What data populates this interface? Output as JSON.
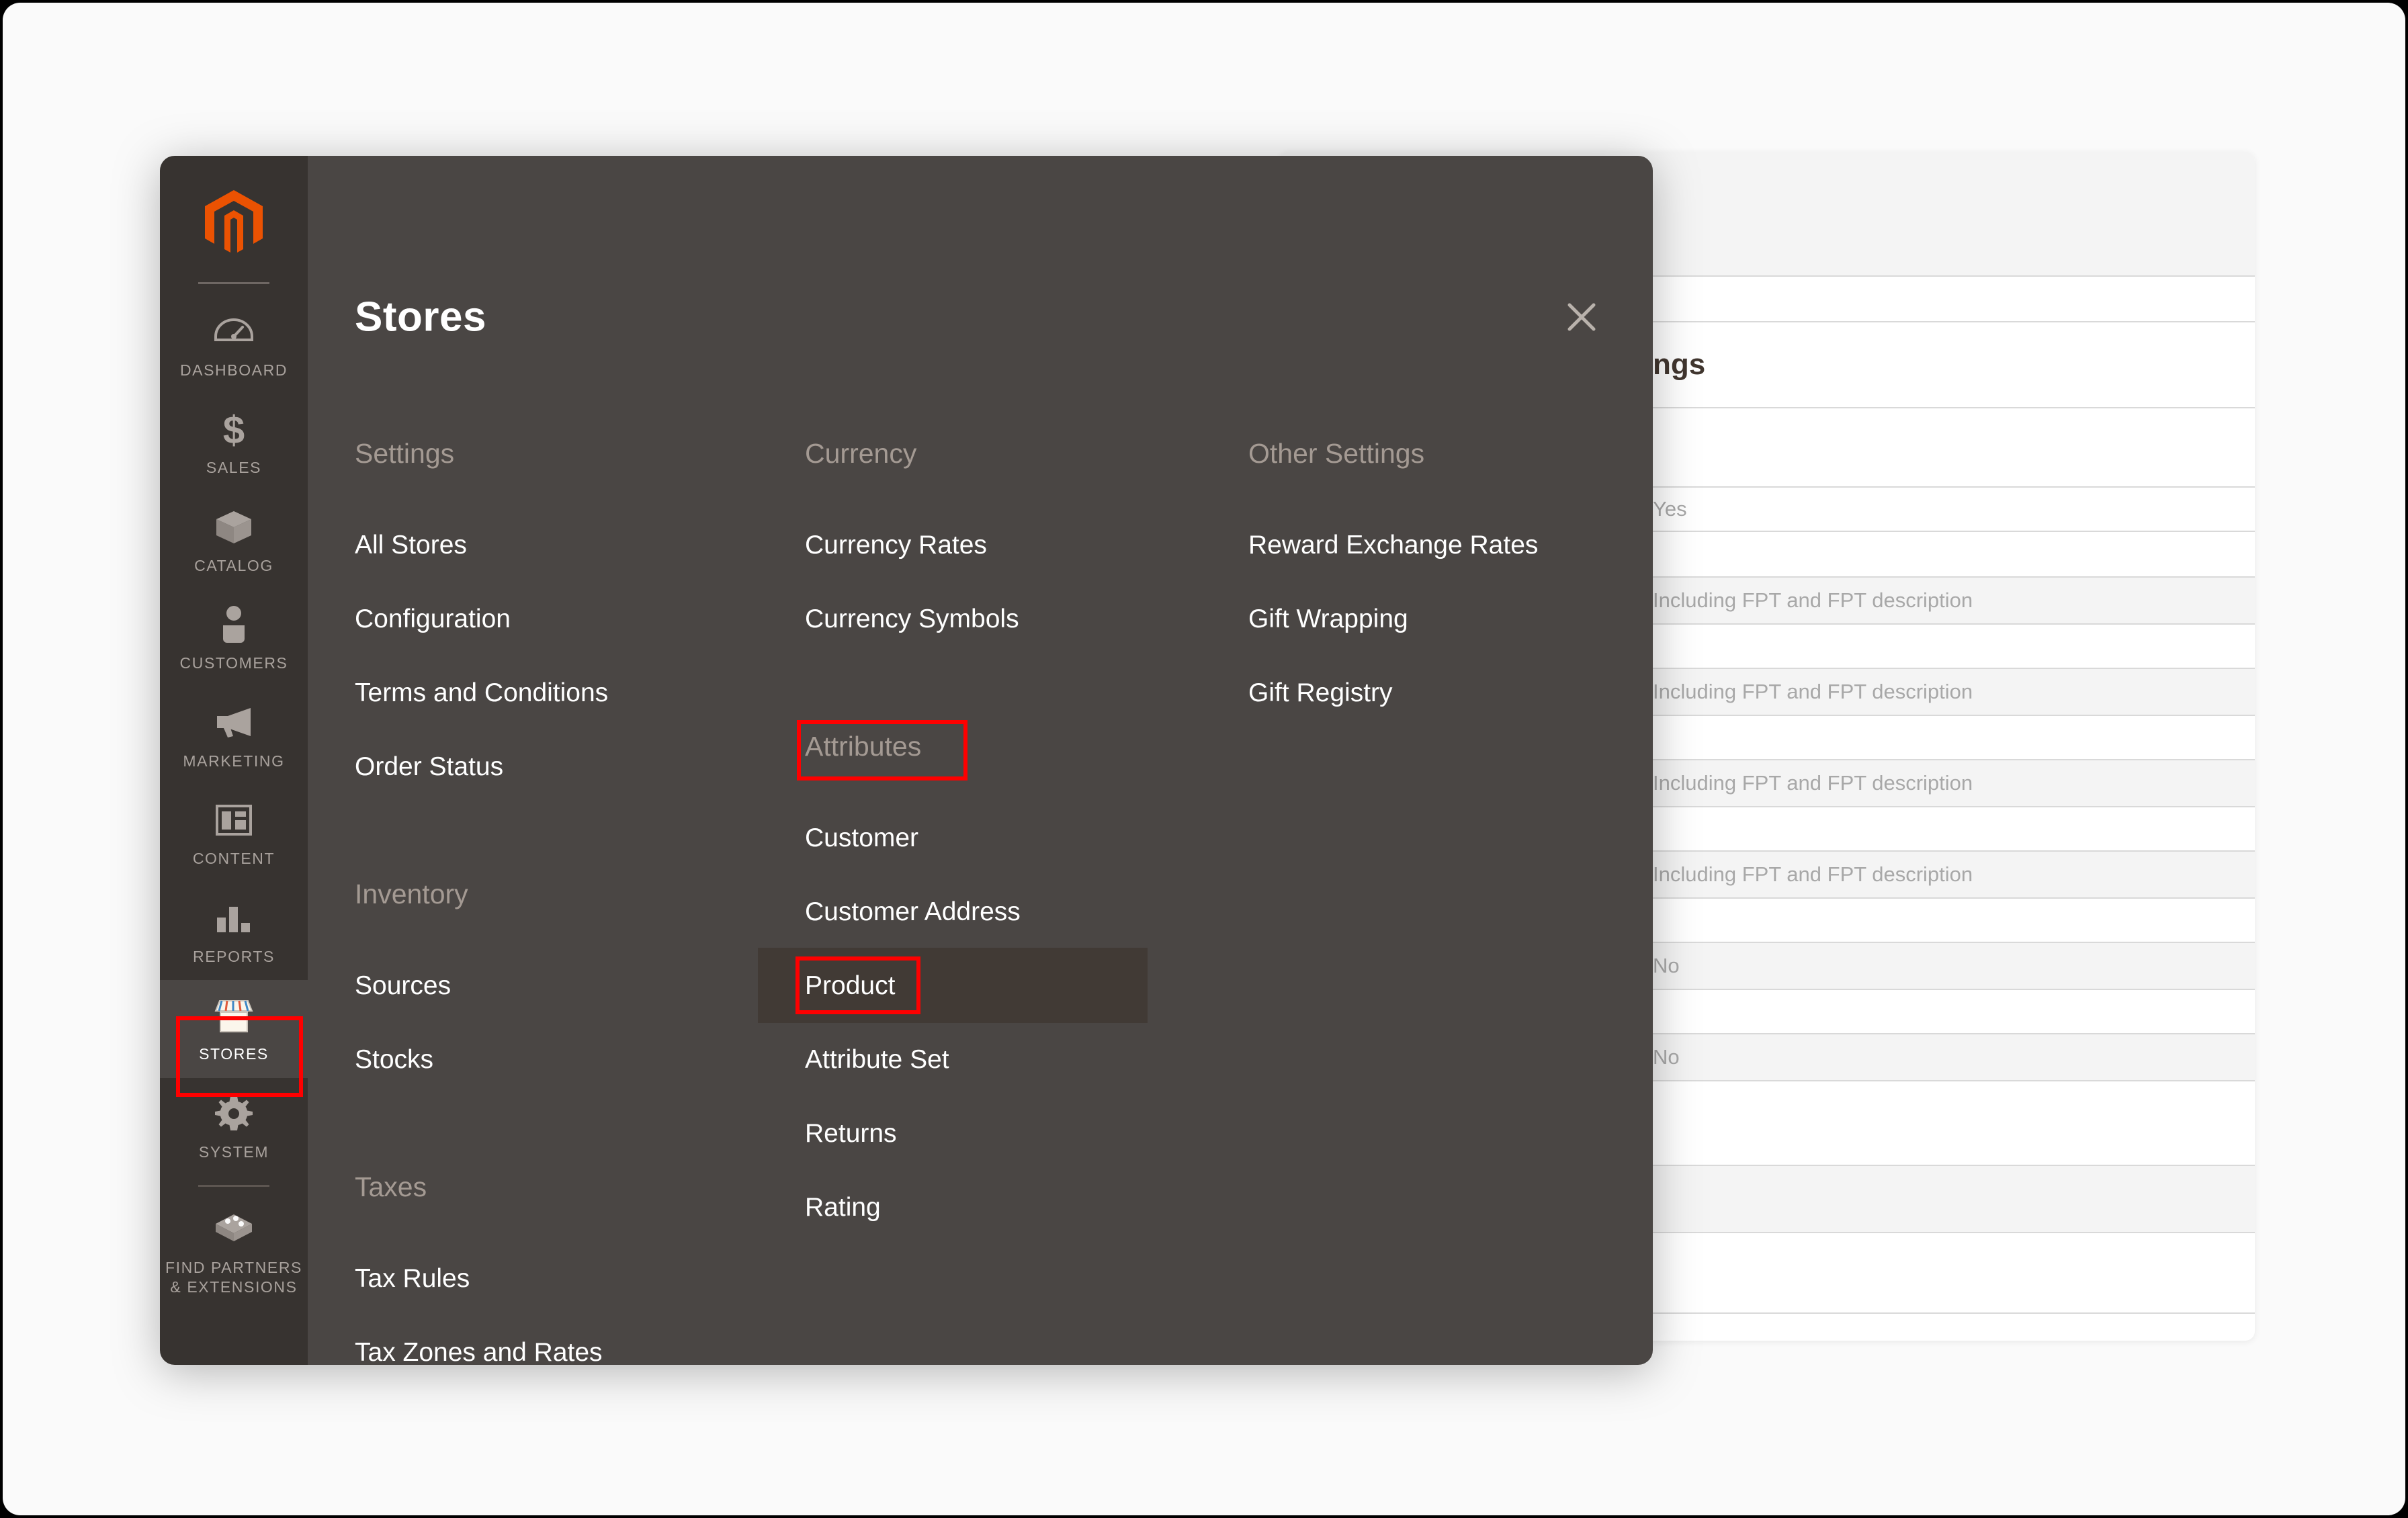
{
  "app": {
    "brand_color": "#eb5202",
    "sidebar_bg": "#373330",
    "panel_bg": "#4a4644",
    "highlight_color": "#fe0000",
    "hover_row_bg": "#413a35"
  },
  "sidebar": {
    "logo_name": "magento-logo",
    "items": [
      {
        "label": "DASHBOARD",
        "icon": "gauge-icon",
        "active": false
      },
      {
        "label": "SALES",
        "icon": "dollar-icon",
        "active": false
      },
      {
        "label": "CATALOG",
        "icon": "box-icon",
        "active": false
      },
      {
        "label": "CUSTOMERS",
        "icon": "person-icon",
        "active": false
      },
      {
        "label": "MARKETING",
        "icon": "megaphone-icon",
        "active": false
      },
      {
        "label": "CONTENT",
        "icon": "layout-icon",
        "active": false
      },
      {
        "label": "REPORTS",
        "icon": "bar-chart-icon",
        "active": false
      },
      {
        "label": "STORES",
        "icon": "storefront-icon",
        "active": true
      },
      {
        "label": "SYSTEM",
        "icon": "gear-icon",
        "active": false
      },
      {
        "label": "FIND PARTNERS\n& EXTENSIONS",
        "icon": "extension-icon",
        "active": false
      }
    ]
  },
  "modal": {
    "title": "Stores",
    "close_label": "close-icon"
  },
  "menu": {
    "columns": [
      {
        "id": "settings",
        "groups": [
          {
            "heading": "Settings",
            "items": [
              "All Stores",
              "Configuration",
              "Terms and Conditions",
              "Order Status"
            ]
          },
          {
            "heading": "Inventory",
            "items": [
              "Sources",
              "Stocks"
            ]
          },
          {
            "heading": "Taxes",
            "items": [
              "Tax Rules",
              "Tax Zones and Rates"
            ]
          }
        ]
      },
      {
        "id": "currency",
        "groups": [
          {
            "heading": "Currency",
            "items": [
              "Currency Rates",
              "Currency Symbols"
            ]
          },
          {
            "heading": "Attributes",
            "heading_highlighted": true,
            "items": [
              "Customer",
              "Customer Address",
              "Product",
              "Attribute Set",
              "Returns",
              "Rating"
            ],
            "highlighted_item": "Product",
            "hovered_item": "Product"
          }
        ]
      },
      {
        "id": "other",
        "groups": [
          {
            "heading": "Other Settings",
            "items": [
              "Reward Exchange Rates",
              "Gift Wrapping",
              "Gift Registry"
            ]
          }
        ]
      }
    ]
  },
  "background_page": {
    "partial_title": "ngs",
    "rows": [
      {
        "text": "",
        "shaded": true,
        "height": 186
      },
      {
        "text": "",
        "shaded": false,
        "height": 68
      },
      {
        "text": "ngs",
        "shaded": false,
        "height": 128,
        "is_title": true
      },
      {
        "text": "",
        "shaded": false,
        "height": 118
      },
      {
        "text": "Yes",
        "shaded": false,
        "height": 66
      },
      {
        "text": "",
        "shaded": false,
        "height": 68
      },
      {
        "text": "Including FPT and FPT description",
        "shaded": true,
        "height": 70
      },
      {
        "text": "",
        "shaded": false,
        "height": 66
      },
      {
        "text": "Including FPT and FPT description",
        "shaded": true,
        "height": 70
      },
      {
        "text": "",
        "shaded": false,
        "height": 66
      },
      {
        "text": "Including FPT and FPT description",
        "shaded": true,
        "height": 70
      },
      {
        "text": "",
        "shaded": false,
        "height": 66
      },
      {
        "text": "Including FPT and FPT description",
        "shaded": true,
        "height": 70
      },
      {
        "text": "",
        "shaded": false,
        "height": 66
      },
      {
        "text": "No",
        "shaded": true,
        "height": 70
      },
      {
        "text": "",
        "shaded": false,
        "height": 66
      },
      {
        "text": "No",
        "shaded": true,
        "height": 70
      },
      {
        "text": "",
        "shaded": false,
        "height": 126
      },
      {
        "text": "",
        "shaded": true,
        "height": 100
      },
      {
        "text": "",
        "shaded": false,
        "height": 120
      }
    ]
  }
}
